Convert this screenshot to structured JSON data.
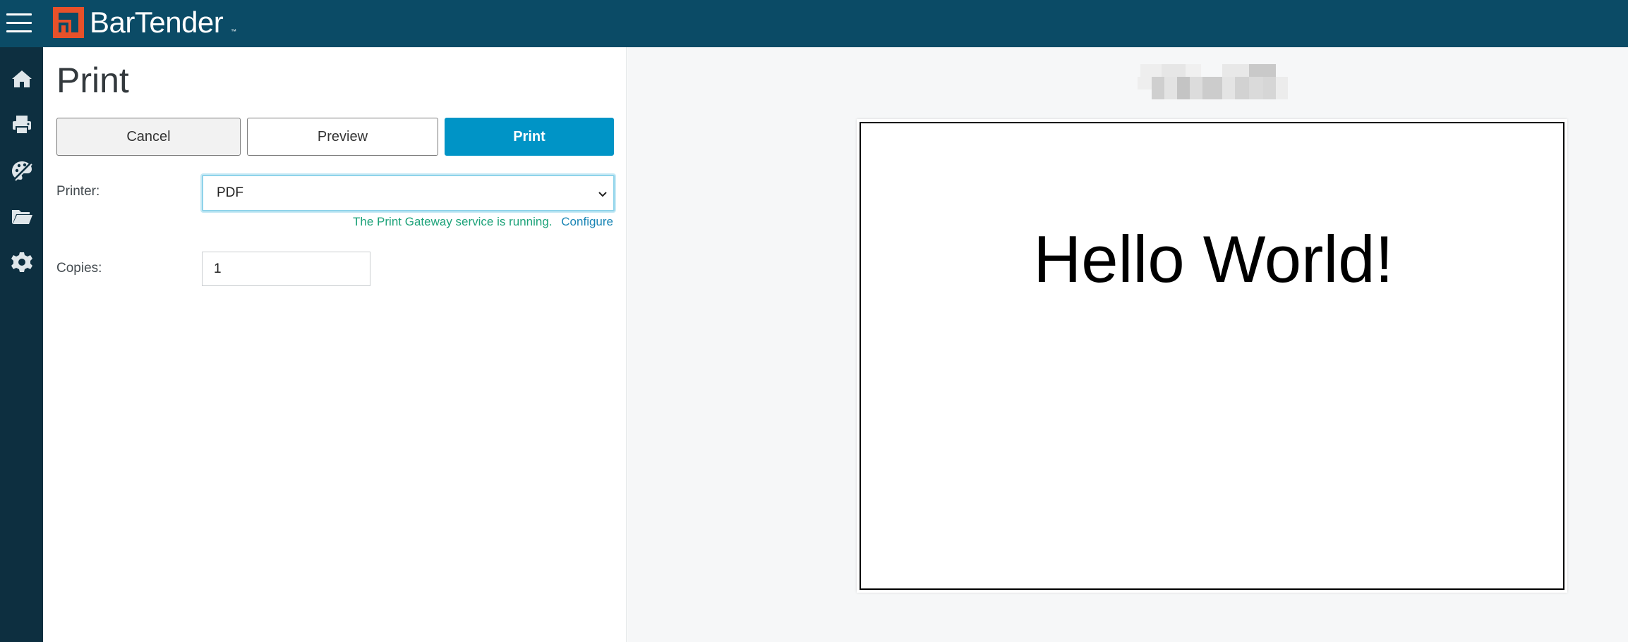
{
  "app": {
    "brand": "BarTender",
    "brand_tm": "™",
    "brand_color": "#0b4b66",
    "accent_color": "#0094c6",
    "logo_color": "#e8512a"
  },
  "rail": {
    "items": [
      {
        "name": "home-icon"
      },
      {
        "name": "printer-icon"
      },
      {
        "name": "design-icon"
      },
      {
        "name": "folder-icon"
      },
      {
        "name": "gear-icon"
      }
    ]
  },
  "page": {
    "title": "Print"
  },
  "actions": {
    "cancel_label": "Cancel",
    "preview_label": "Preview",
    "print_label": "Print"
  },
  "form": {
    "printer_label": "Printer:",
    "printer_value": "PDF",
    "status_text": "The Print Gateway service is running.",
    "configure_label": "Configure",
    "copies_label": "Copies:",
    "copies_value": "1"
  },
  "preview": {
    "label_text": "Hello World!"
  }
}
